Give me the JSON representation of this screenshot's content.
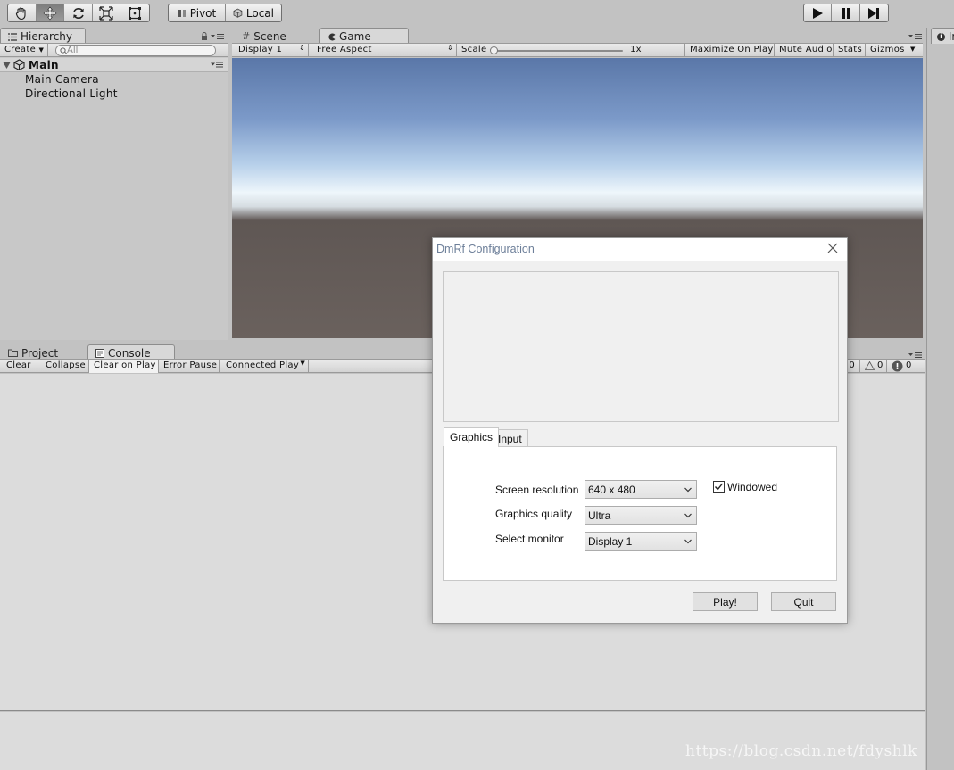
{
  "toolbar": {
    "pivot_label": "Pivot",
    "local_label": "Local"
  },
  "hierarchy": {
    "tab_label": "Hierarchy",
    "create_label": "Create",
    "search_placeholder": "All",
    "scene_name": "Main",
    "items": [
      {
        "label": "Main Camera"
      },
      {
        "label": "Directional Light"
      }
    ]
  },
  "game_panel": {
    "tabs": [
      {
        "label": "Scene"
      },
      {
        "label": "Game"
      }
    ],
    "display_label": "Display 1",
    "aspect_label": "Free Aspect",
    "scale_label": "Scale",
    "scale_value": "1x",
    "maximize_label": "Maximize On Play",
    "mute_label": "Mute Audio",
    "stats_label": "Stats",
    "gizmos_label": "Gizmos"
  },
  "console_panel": {
    "tabs": [
      {
        "label": "Project"
      },
      {
        "label": "Console"
      }
    ],
    "clear_label": "Clear",
    "collapse_label": "Collapse",
    "clear_on_play_label": "Clear on Play",
    "error_pause_label": "Error Pause",
    "connected_player_label": "Connected Player",
    "info_count": "0",
    "warning_count": "0",
    "error_count": "0"
  },
  "inspector": {
    "tab_label": "In"
  },
  "dialog": {
    "title": "DmRf Configuration",
    "tabs": [
      {
        "label": "Graphics"
      },
      {
        "label": "Input"
      }
    ],
    "screen_resolution_label": "Screen resolution",
    "screen_resolution_value": "640 x 480",
    "graphics_quality_label": "Graphics quality",
    "graphics_quality_value": "Ultra",
    "select_monitor_label": "Select monitor",
    "select_monitor_value": "Display 1",
    "windowed_label": "Windowed",
    "windowed_checked": true,
    "play_label": "Play!",
    "quit_label": "Quit"
  },
  "watermark": "https://blog.csdn.net/fdyshlk"
}
